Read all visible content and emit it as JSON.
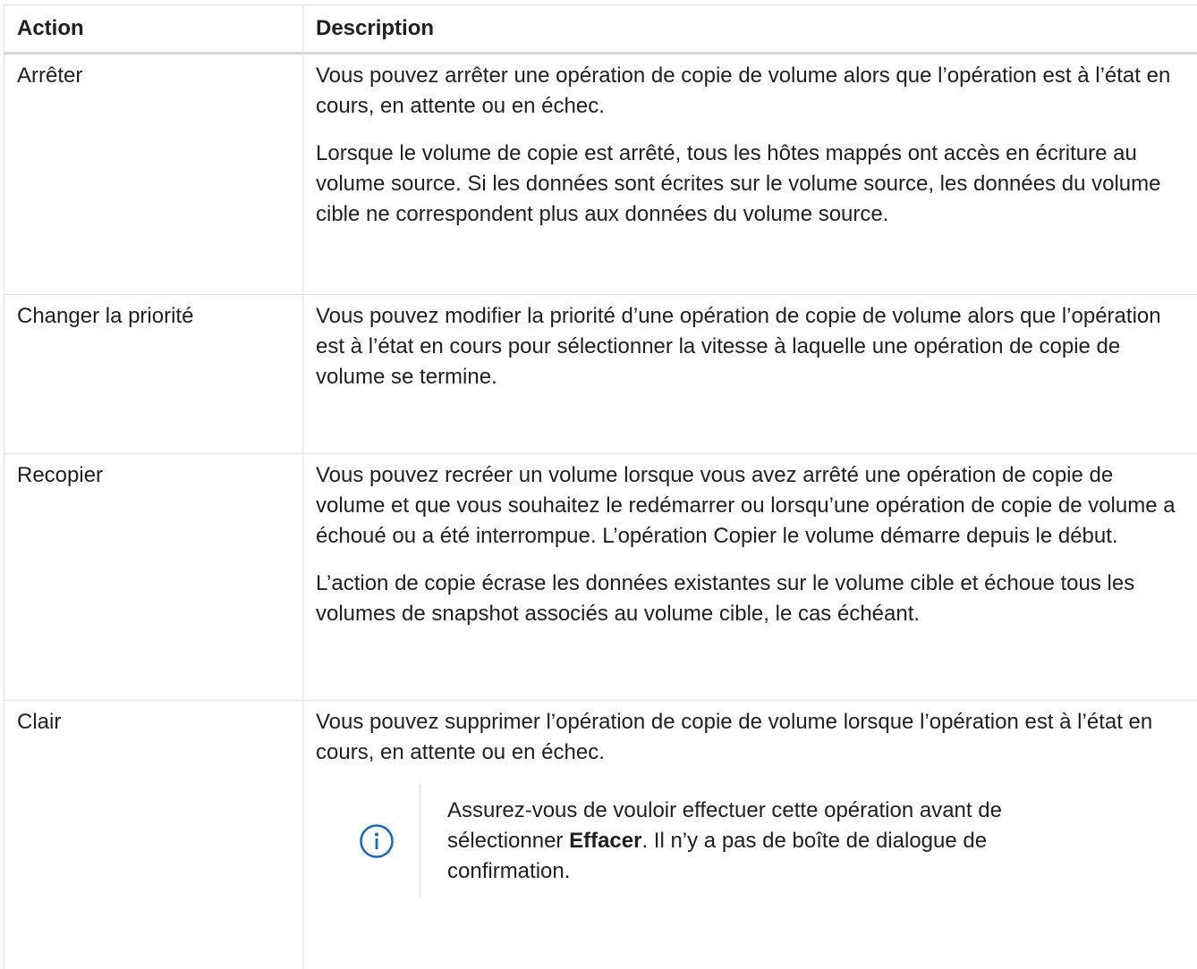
{
  "table": {
    "headers": {
      "action": "Action",
      "description": "Description"
    },
    "rows": [
      {
        "action": "Arrêter",
        "paragraphs": [
          "Vous pouvez arrêter une opération de copie de volume alors que l’opération est à l’état en cours, en attente ou en échec.",
          "Lorsque le volume de copie est arrêté, tous les hôtes mappés ont accès en écriture au volume source. Si les données sont écrites sur le volume source, les données du volume cible ne correspondent plus aux données du volume source."
        ]
      },
      {
        "action": "Changer la priorité",
        "paragraphs": [
          "Vous pouvez modifier la priorité d’une opération de copie de volume alors que l’opération est à l’état en cours pour sélectionner la vitesse à laquelle une opération de copie de volume se termine."
        ]
      },
      {
        "action": "Recopier",
        "paragraphs": [
          "Vous pouvez recréer un volume lorsque vous avez arrêté une opération de copie de volume et que vous souhaitez le redémarrer ou lorsqu’une opération de copie de volume a échoué ou a été interrompue. L’opération Copier le volume démarre depuis le début.",
          "L’action de copie écrase les données existantes sur le volume cible et échoue tous les volumes de snapshot associés au volume cible, le cas échéant."
        ]
      },
      {
        "action": "Clair",
        "paragraphs": [
          "Vous pouvez supprimer l’opération de copie de volume lorsque l’opération est à l’état en cours, en attente ou en échec."
        ],
        "note": {
          "icon": "info-icon",
          "icon_color": "#1a66b8",
          "text_before": "Assurez-vous de vouloir effectuer cette opération avant de sélectionner ",
          "text_bold": "Effacer",
          "text_after": ". Il n’y a pas de boîte de dialogue de confirmation."
        }
      }
    ]
  }
}
